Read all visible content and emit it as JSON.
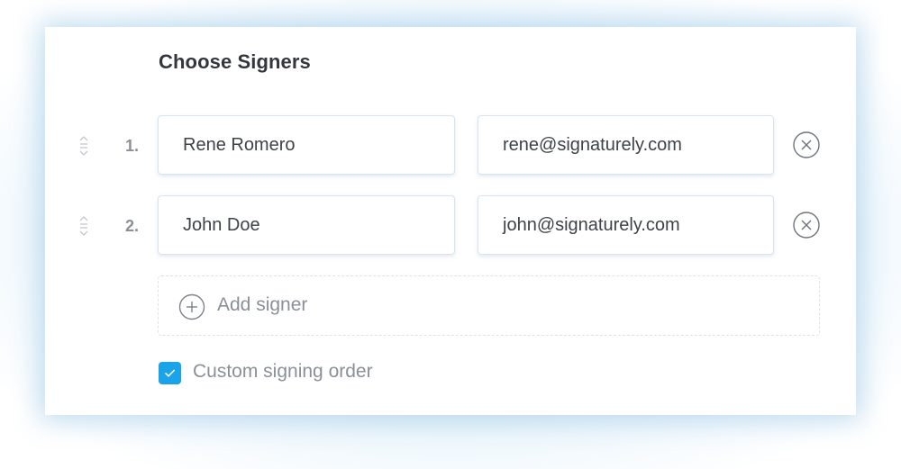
{
  "title": "Choose Signers",
  "signers": [
    {
      "number": "1.",
      "name": "Rene Romero",
      "email": "rene@signaturely.com"
    },
    {
      "number": "2.",
      "name": "John Doe",
      "email": "john@signaturely.com"
    }
  ],
  "add_signer_label": "Add signer",
  "custom_order": {
    "label": "Custom signing order",
    "checked": true
  },
  "icons": {
    "drag": "drag-handle-icon",
    "remove": "close-circle-icon",
    "add": "plus-circle-icon",
    "check": "checkmark-icon"
  },
  "colors": {
    "accent": "#1aa3e8",
    "title": "#33373d",
    "muted": "#8a8f98",
    "text": "#3e4249"
  }
}
